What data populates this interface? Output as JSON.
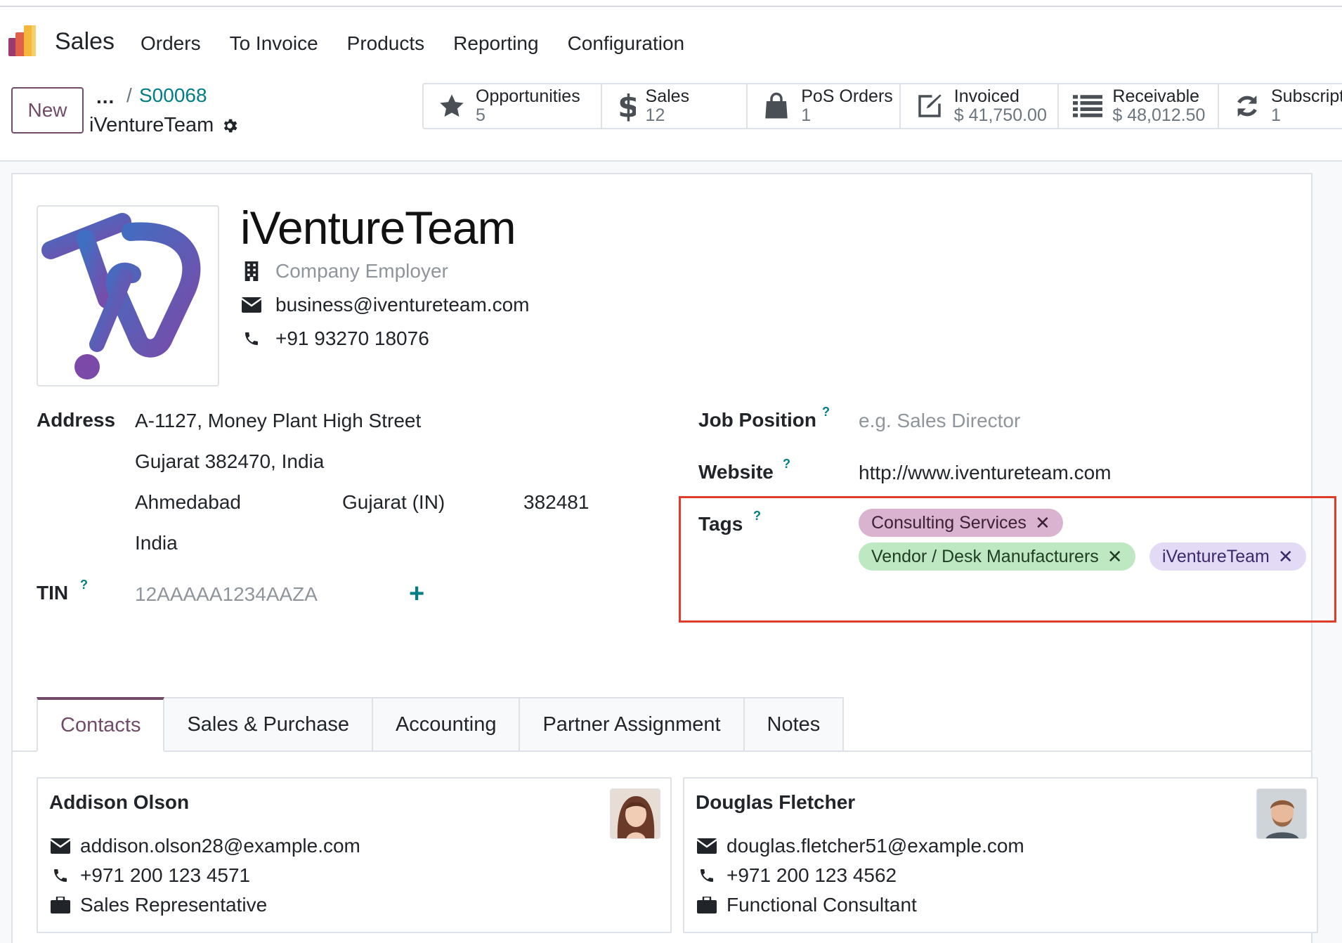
{
  "navbar": {
    "app_name": "Sales",
    "menu": [
      "Orders",
      "To Invoice",
      "Products",
      "Reporting",
      "Configuration"
    ]
  },
  "control_panel": {
    "new_label": "New",
    "breadcrumb_dots": "...",
    "breadcrumb_sep": "/",
    "breadcrumb_link": "S00068",
    "current_record": "iVentureTeam"
  },
  "smart_buttons": [
    {
      "label": "Opportunities",
      "value": "5",
      "icon": "star-icon"
    },
    {
      "label": "Sales",
      "value": "12",
      "icon": "dollar-icon"
    },
    {
      "label": "PoS Orders",
      "value": "1",
      "icon": "shopping-bag-icon"
    },
    {
      "label": "Invoiced",
      "value": "$ 41,750.00",
      "icon": "edit-icon"
    },
    {
      "label": "Receivable",
      "value": "$ 48,012.50",
      "icon": "list-icon"
    },
    {
      "label": "Subscripti",
      "value": "1",
      "icon": "refresh-icon"
    }
  ],
  "partner": {
    "name": "iVentureTeam",
    "company_placeholder": "Company Employer",
    "email": "business@iventureteam.com",
    "phone": "+91 93270 18076"
  },
  "address": {
    "label": "Address",
    "street": "A-1127, Money Plant High Street",
    "street2": "Gujarat 382470, India",
    "city": "Ahmedabad",
    "state": "Gujarat (IN)",
    "zip": "382481",
    "country": "India"
  },
  "tin": {
    "label": "TIN",
    "placeholder": "12AAAAA1234AAZA",
    "help": "?"
  },
  "job_position": {
    "label": "Job Position",
    "placeholder": "e.g. Sales Director",
    "help": "?"
  },
  "website": {
    "label": "Website",
    "value": "http://www.iventureteam.com",
    "help": "?"
  },
  "tags": {
    "label": "Tags",
    "help": "?",
    "items": [
      {
        "label": "Consulting Services",
        "bg": "#d9b3d0",
        "fg": "#3d2036"
      },
      {
        "label": "Vendor / Desk Manufacturers",
        "bg": "#bde8c2",
        "fg": "#1f3d22"
      },
      {
        "label": "iVentureTeam",
        "bg": "#e3daf5",
        "fg": "#3b2a6b"
      }
    ],
    "remove_glyph": "✕"
  },
  "tabs": [
    "Contacts",
    "Sales & Purchase",
    "Accounting",
    "Partner Assignment",
    "Notes"
  ],
  "contacts": [
    {
      "name": "Addison Olson",
      "email": "addison.olson28@example.com",
      "phone": "+971 200 123 4571",
      "function": "Sales Representative"
    },
    {
      "name": "Douglas Fletcher",
      "email": "douglas.fletcher51@example.com",
      "phone": "+971 200 123 4562",
      "function": "Functional Consultant"
    }
  ],
  "colors": {
    "brand": "#714B67",
    "link": "#017e84",
    "highlight_border": "#e03c2a"
  }
}
